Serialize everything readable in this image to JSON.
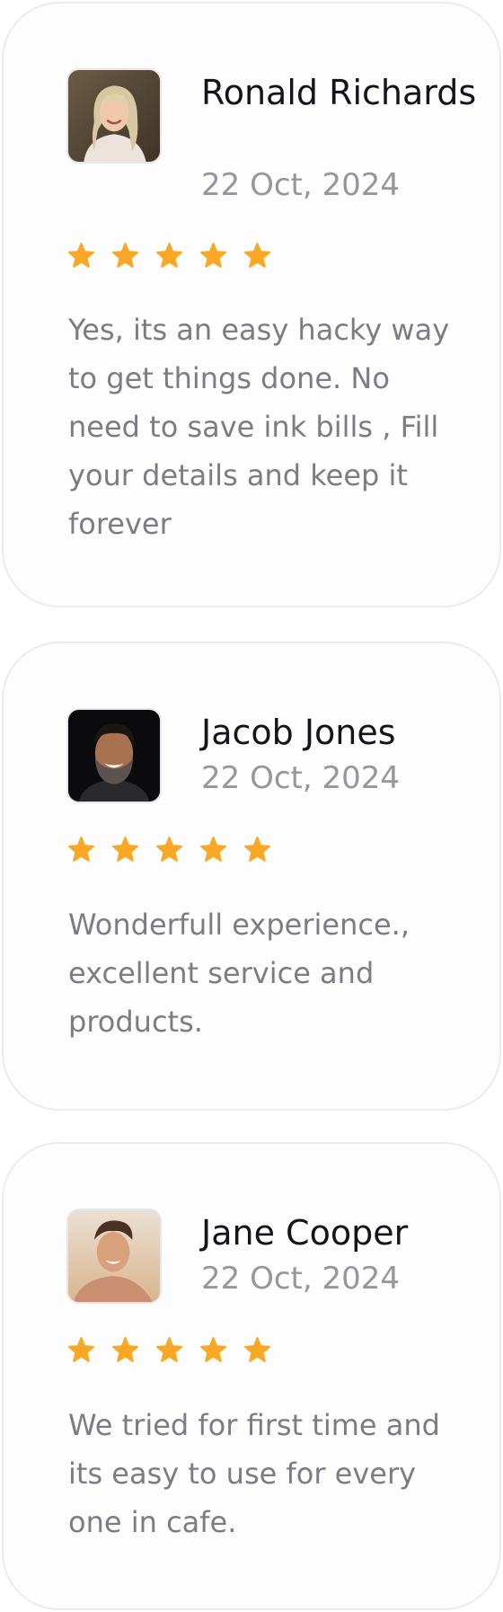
{
  "reviews": [
    {
      "name": "Ronald Richards",
      "date": "22 Oct, 2024",
      "rating": 5,
      "text": "Yes, its an easy hacky way to get things done. No need to save ink bills , Fill your details and keep it forever"
    },
    {
      "name": "Jacob Jones",
      "date": "22 Oct, 2024",
      "rating": 5,
      "text": "Wonderfull experience., excellent service and products."
    },
    {
      "name": "Jane Cooper",
      "date": "22 Oct, 2024",
      "rating": 5,
      "text": "We tried for first time and its easy to use for every one in cafe."
    }
  ],
  "colors": {
    "star": "#f9a825",
    "name": "#14141c",
    "date": "#96969e",
    "text": "#7c7c84",
    "border": "#ebebf3"
  },
  "icons": {
    "rating": "star-icon"
  }
}
